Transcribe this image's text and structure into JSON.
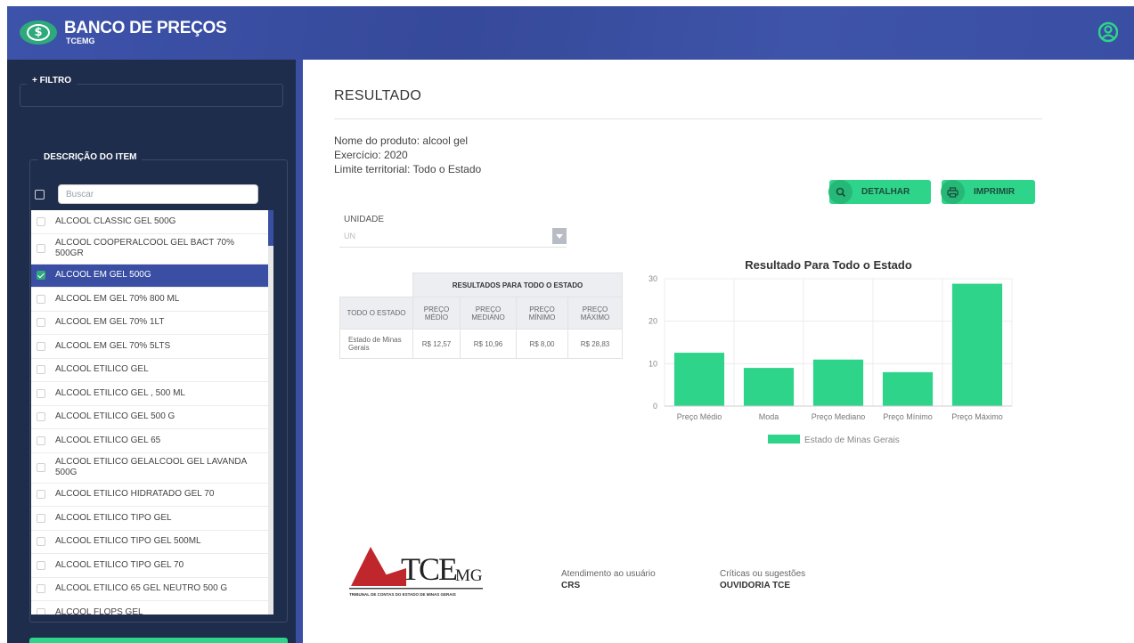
{
  "app": {
    "brand": "BANCO DE PREÇOS",
    "subbrand": "TCEMG",
    "logo_glyph": "$"
  },
  "sidebar": {
    "filter_label": "+ FILTRO",
    "desc_label": "DESCRIÇÃO DO ITEM",
    "search_placeholder": "Buscar",
    "items": [
      {
        "label": "ALCOOL CLASSIC GEL 500G",
        "selected": false
      },
      {
        "label": "ALCOOL COOPERALCOOL GEL BACT 70% 500GR",
        "selected": false
      },
      {
        "label": "ALCOOL EM GEL 500G",
        "selected": true
      },
      {
        "label": "ALCOOL EM GEL 70% 800 ML",
        "selected": false
      },
      {
        "label": "ALCOOL EM GEL 70% 1LT",
        "selected": false
      },
      {
        "label": "ALCOOL EM GEL 70% 5LTS",
        "selected": false
      },
      {
        "label": "ALCOOL ETILICO GEL",
        "selected": false
      },
      {
        "label": "ALCOOL ETILICO GEL , 500 ML",
        "selected": false
      },
      {
        "label": "ALCOOL ETILICO GEL 500 G",
        "selected": false
      },
      {
        "label": "ALCOOL ETILICO GEL 65",
        "selected": false
      },
      {
        "label": "ALCOOL ETILICO GELALCOOL GEL LAVANDA 500G",
        "selected": false
      },
      {
        "label": "ALCOOL ETILICO HIDRATADO GEL 70",
        "selected": false
      },
      {
        "label": "ALCOOL ETILICO TIPO GEL",
        "selected": false
      },
      {
        "label": "ALCOOL ETILICO TIPO GEL 500ML",
        "selected": false
      },
      {
        "label": "ALCOOL ETILICO TIPO GEL 70",
        "selected": false
      },
      {
        "label": "ALCOOL ETILICO 65 GEL NEUTRO 500 G",
        "selected": false
      },
      {
        "label": "ALCOOL FLOPS GEL",
        "selected": false
      }
    ]
  },
  "main": {
    "title": "RESULTADO",
    "product": "Nome do produto: alcool gel",
    "year": "Exercício: 2020",
    "territory": "Limite territorial: Todo o Estado",
    "btn_detail": "DETALHAR",
    "btn_print": "IMPRIMIR",
    "unit_label": "UNIDADE",
    "unit_value": "UN"
  },
  "table": {
    "group_header": "RESULTADOS PARA TODO O ESTADO",
    "col0": "TODO O ESTADO",
    "cols": [
      "PREÇO MÉDIO",
      "PREÇO MEDIANO",
      "PREÇO MÍNIMO",
      "PREÇO MÁXIMO"
    ],
    "row_label": "Estado de Minas Gerais",
    "row_values": [
      "R$ 12,57",
      "R$ 10,96",
      "R$ 8,00",
      "R$ 28,83"
    ]
  },
  "chart_data": {
    "type": "bar",
    "title": "Resultado Para Todo o Estado",
    "categories": [
      "Preço Médio",
      "Moda",
      "Preço Mediano",
      "Preço Mínimo",
      "Preço Máximo"
    ],
    "series": [
      {
        "name": "Estado de Minas Gerais",
        "values": [
          12.57,
          9.0,
          10.96,
          8.0,
          28.83
        ]
      }
    ],
    "ylim": [
      0,
      30
    ],
    "yticks": [
      0,
      10,
      20,
      30
    ],
    "legend_position": "bottom",
    "grid": true,
    "color": "#2ed48a"
  },
  "footer": {
    "logo_text": "TCE",
    "logo_suffix": "MG",
    "logo_caption": "TRIBUNAL DE CONTAS DO ESTADO DE MINAS GERAIS",
    "support_label": "Atendimento ao usuário",
    "support_value": "CRS",
    "feedback_label": "Críticas ou sugestões",
    "feedback_value": "OUVIDORIA TCE"
  },
  "colors": {
    "primary": "#3a4fa3",
    "sidebar": "#1f2d4c",
    "accent": "#2ed48a"
  },
  "icons": [
    "dollar-logo-icon",
    "user-icon",
    "search-icon",
    "printer-icon"
  ]
}
